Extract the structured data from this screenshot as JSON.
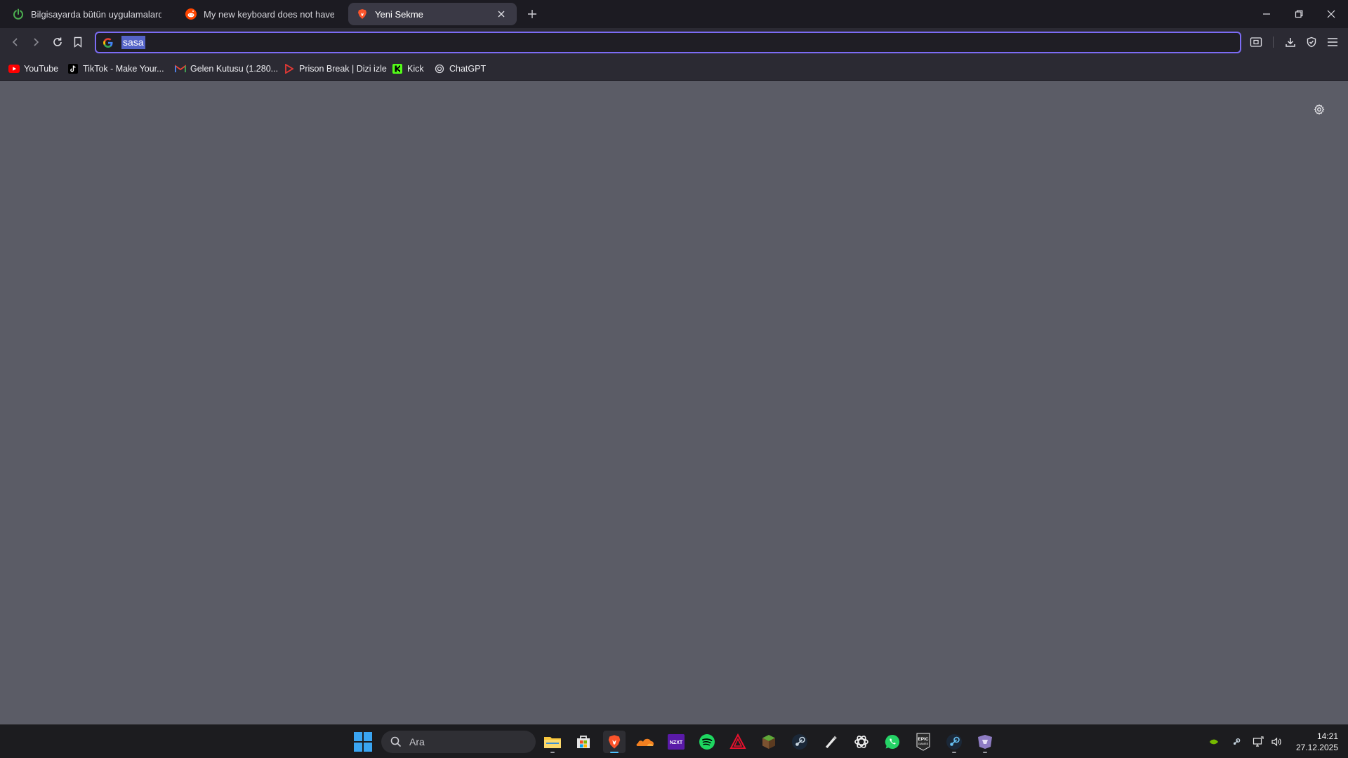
{
  "tabs": [
    {
      "title": "Bilgisayarda bütün uygulamalardan ç",
      "icon": "power-icon",
      "active": false
    },
    {
      "title": "My new keyboard does not have a Pr",
      "icon": "reddit-icon",
      "active": false
    },
    {
      "title": "Yeni Sekme",
      "icon": "brave-icon",
      "active": true
    }
  ],
  "address_bar": {
    "value": "sasa",
    "search_engine_icon": "google-icon"
  },
  "bookmarks": [
    {
      "label": "YouTube",
      "icon": "youtube-icon"
    },
    {
      "label": "TikTok - Make Your...",
      "icon": "tiktok-icon"
    },
    {
      "label": "Gelen Kutusu (1.280...",
      "icon": "gmail-icon"
    },
    {
      "label": "Prison Break | Dizi izle",
      "icon": "play-icon"
    },
    {
      "label": "Kick",
      "icon": "kick-icon"
    },
    {
      "label": "ChatGPT",
      "icon": "chatgpt-icon"
    }
  ],
  "taskbar": {
    "search_label": "Ara",
    "apps": [
      "file-explorer",
      "microsoft-store",
      "brave",
      "cloudflare",
      "nzxt",
      "spotify",
      "armoury",
      "minecraft",
      "steam",
      "pen",
      "chatgpt",
      "whatsapp",
      "epic-games",
      "steam-2",
      "app"
    ],
    "time": "14:21",
    "date": "27.12.2025"
  },
  "colors": {
    "accent": "#7c6cf5",
    "content_bg": "#5b5c66",
    "tab_bar": "#1c1b22",
    "toolbar": "#2b2a33",
    "taskbar": "#1c1c1f"
  }
}
